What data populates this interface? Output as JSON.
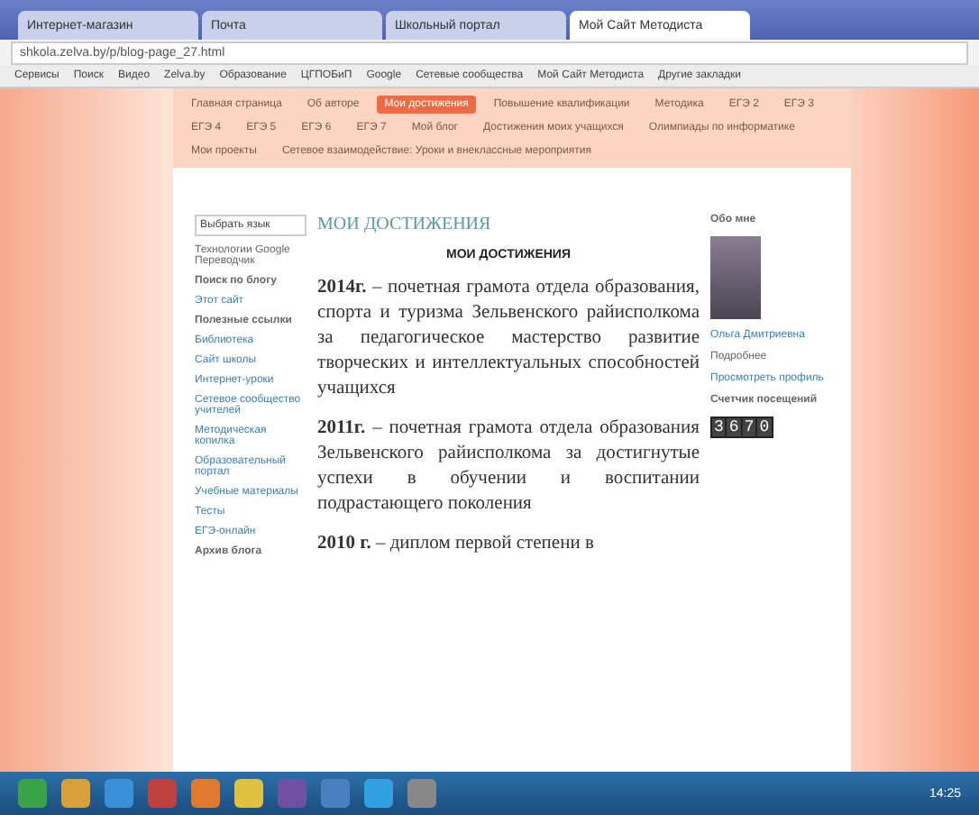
{
  "browser": {
    "tabs": [
      {
        "title": "Интернет-магазин",
        "selected": false
      },
      {
        "title": "Почта",
        "selected": false
      },
      {
        "title": "Школьный портал",
        "selected": false
      },
      {
        "title": "Мой Сайт Методиста",
        "selected": true
      }
    ],
    "address": "shkola.zelva.by/p/blog-page_27.html",
    "bookmarks": [
      "Сервисы",
      "Поиск",
      "Видео",
      "Zelva.by",
      "Образование",
      "ЦГПОБиП",
      "Google",
      "Сетевые сообщества",
      "Мой Сайт Методиста",
      "Другие закладки"
    ]
  },
  "nav": [
    {
      "label": "Главная страница",
      "selected": false
    },
    {
      "label": "Об авторе",
      "selected": false
    },
    {
      "label": "Мои достижения",
      "selected": true
    },
    {
      "label": "Повышение квалификации",
      "selected": false
    },
    {
      "label": "Методика",
      "selected": false
    },
    {
      "label": "ЕГЭ 2",
      "selected": false
    },
    {
      "label": "ЕГЭ 3",
      "selected": false
    },
    {
      "label": "ЕГЭ 4",
      "selected": false
    },
    {
      "label": "ЕГЭ 5",
      "selected": false
    },
    {
      "label": "ЕГЭ 6",
      "selected": false
    },
    {
      "label": "ЕГЭ 7",
      "selected": false
    },
    {
      "label": "Мой блог",
      "selected": false
    },
    {
      "label": "Достижения моих учащихся",
      "selected": false
    },
    {
      "label": "Олимпиады по информатике",
      "selected": false
    },
    {
      "label": "Мои проекты",
      "selected": false
    },
    {
      "label": "Сетевое взаимодействие: Уроки и внеклассные мероприятия",
      "selected": false
    }
  ],
  "sidebar": {
    "language_select": "Выбрать язык",
    "translate_note": "Технологии Google Переводчик",
    "search_title": "Поиск по блогу",
    "search_link": "Этот сайт",
    "links_title": "Полезные ссылки",
    "links": [
      "Библиотека",
      "Сайт школы",
      "Интернет-уроки",
      "Сетевое сообщество учителей",
      "Методическая копилка",
      "Образовательный портал",
      "Учебные материалы",
      "Тесты",
      "ЕГЭ-онлайн"
    ],
    "footer_title": "Архив блога"
  },
  "main": {
    "heading": "МОИ ДОСТИЖЕНИЯ",
    "subheading": "МОИ ДОСТИЖЕНИЯ",
    "paragraphs": [
      "**2014г.** – почетная грамота отдела образования, спорта и туризма Зельвенского райисполкома за педагогическое мастерство развитие творческих и интеллектуальных способностей учащихся",
      "**2011г.** – почетная грамота отдела образования Зельвенского райисполкома за достигнутые успехи в обучении и воспитании подрастающего поколения",
      "**2010 г.** – диплом первой степени в"
    ]
  },
  "profile": {
    "title": "Обо мне",
    "name": "Ольга Дмитриевна",
    "role": "Подробнее",
    "link": "Просмотреть профиль"
  },
  "counter": {
    "title": "Счетчик посещений",
    "digits": [
      "3",
      "6",
      "7",
      "0"
    ]
  },
  "taskbar": {
    "time": "14:25"
  }
}
